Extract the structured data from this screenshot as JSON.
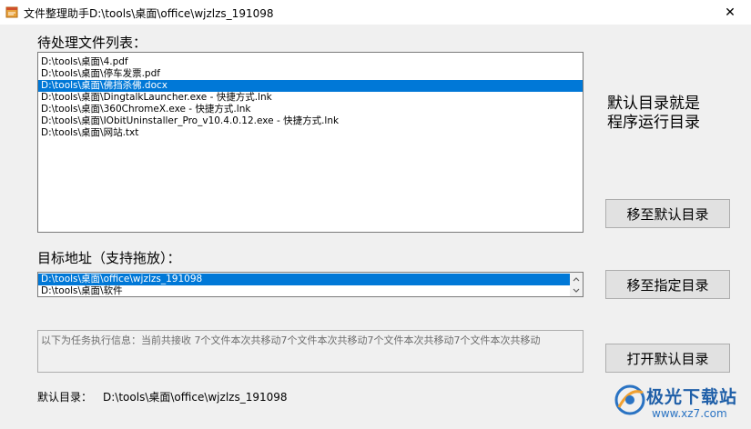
{
  "window": {
    "title": "文件整理助手D:\\tools\\桌面\\office\\wjzlzs_191098",
    "close_glyph": "✕"
  },
  "file_list": {
    "label": "待处理文件列表：",
    "items": [
      "D:\\tools\\桌面\\4.pdf",
      "D:\\tools\\桌面\\停车发票.pdf",
      "D:\\tools\\桌面\\佛挡杀佛.docx",
      "D:\\tools\\桌面\\DingtalkLauncher.exe - 快捷方式.lnk",
      "D:\\tools\\桌面\\360ChromeX.exe - 快捷方式.lnk",
      "D:\\tools\\桌面\\IObitUninstaller_Pro_v10.4.0.12.exe - 快捷方式.lnk",
      "D:\\tools\\桌面\\网站.txt"
    ],
    "selected_index": 2
  },
  "side_note": {
    "line1": "默认目录就是",
    "line2": "程序运行目录"
  },
  "buttons": {
    "move_default": "移至默认目录",
    "move_specified": "移至指定目录",
    "open_default": "打开默认目录"
  },
  "target": {
    "label": "目标地址（支持拖放）：",
    "items": [
      "D:\\tools\\桌面\\office\\wjzlzs_191098",
      "D:\\tools\\桌面\\软件"
    ],
    "selected_index": 0
  },
  "info": {
    "text": "以下为任务执行信息：当前共接收 7个文件本次共移动7个文件本次共移动7个文件本次共移动7个文件本次共移动"
  },
  "default_dir": {
    "label": "默认目录：",
    "value": "D:\\tools\\桌面\\office\\wjzlzs_191098"
  },
  "watermark": {
    "brand": "极光下载站",
    "url": "www.xz7.com"
  },
  "colors": {
    "selection": "#0078d7",
    "window_bg": "#f0f0f0",
    "button_bg": "#e1e1e1"
  }
}
